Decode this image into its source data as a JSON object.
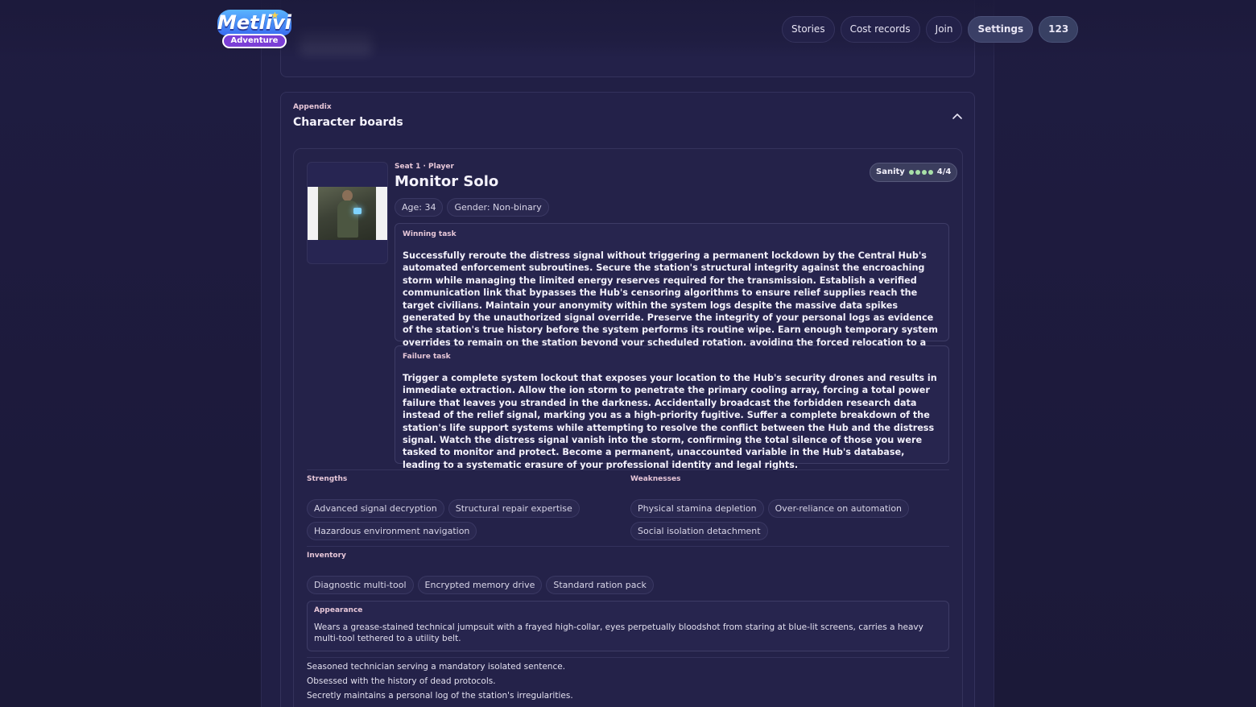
{
  "nav": {
    "logo_primary": "Metlivi",
    "logo_secondary": "Adventure",
    "items": [
      {
        "label": "Stories"
      },
      {
        "label": "Cost records"
      },
      {
        "label": "Join"
      },
      {
        "label": "Settings"
      },
      {
        "label": "123"
      }
    ]
  },
  "appendix": {
    "label": "Appendix",
    "title": "Character boards",
    "toggle_icon": "chevron-up-icon"
  },
  "character": {
    "seat": "Seat 1 · Player",
    "name": "Monitor Solo",
    "sanity": {
      "label": "Sanity",
      "current": 4,
      "max": 4,
      "text": "4/4",
      "dot_color": "#a8e0a8"
    },
    "age": "Age: 34",
    "gender": "Gender: Non-binary",
    "winning_task": {
      "label": "Winning task",
      "text": "Successfully reroute the distress signal without triggering a permanent lockdown by the Central Hub's automated enforcement subroutines. Secure the station's structural integrity against the encroaching storm while managing the limited energy reserves required for the transmission. Establish a verified communication link that bypasses the Hub's censoring algorithms to ensure relief supplies reach the target civilians. Maintain your anonymity within the system logs despite the massive data spikes generated by the unauthorized signal override. Preserve the integrity of your personal logs as evidence of the station's true history before the system performs its routine wipe. Earn enough temporary system overrides to remain on the station beyond your scheduled rotation, avoiding the forced relocation to a processing center."
    },
    "failure_task": {
      "label": "Failure task",
      "text": "Trigger a complete system lockout that exposes your location to the Hub's security drones and results in immediate extraction. Allow the ion storm to penetrate the primary cooling array, forcing a total power failure that leaves you stranded in the darkness. Accidentally broadcast the forbidden research data instead of the relief signal, marking you as a high-priority fugitive. Suffer a complete breakdown of the station's life support systems while attempting to resolve the conflict between the Hub and the distress signal. Watch the distress signal vanish into the storm, confirming the total silence of those you were tasked to monitor and protect. Become a permanent, unaccounted variable in the Hub's database, leading to a systematic erasure of your professional identity and legal rights."
    },
    "strengths": {
      "label": "Strengths",
      "items": [
        "Advanced signal decryption",
        "Structural repair expertise",
        "Hazardous environment navigation"
      ]
    },
    "weaknesses": {
      "label": "Weaknesses",
      "items": [
        "Physical stamina depletion",
        "Over-reliance on automation",
        "Social isolation detachment"
      ]
    },
    "inventory": {
      "label": "Inventory",
      "items": [
        "Diagnostic multi-tool",
        "Encrypted memory drive",
        "Standard ration pack"
      ]
    },
    "appearance": {
      "label": "Appearance",
      "text": "Wears a grease-stained technical jumpsuit with a frayed high-collar, eyes perpetually bloodshot from staring at blue-lit screens, carries a heavy multi-tool tethered to a utility belt."
    },
    "bio": [
      "Seasoned technician serving a mandatory isolated sentence.",
      "Obsessed with the history of dead protocols.",
      "Secretly maintains a personal log of the station's irregularities."
    ]
  }
}
